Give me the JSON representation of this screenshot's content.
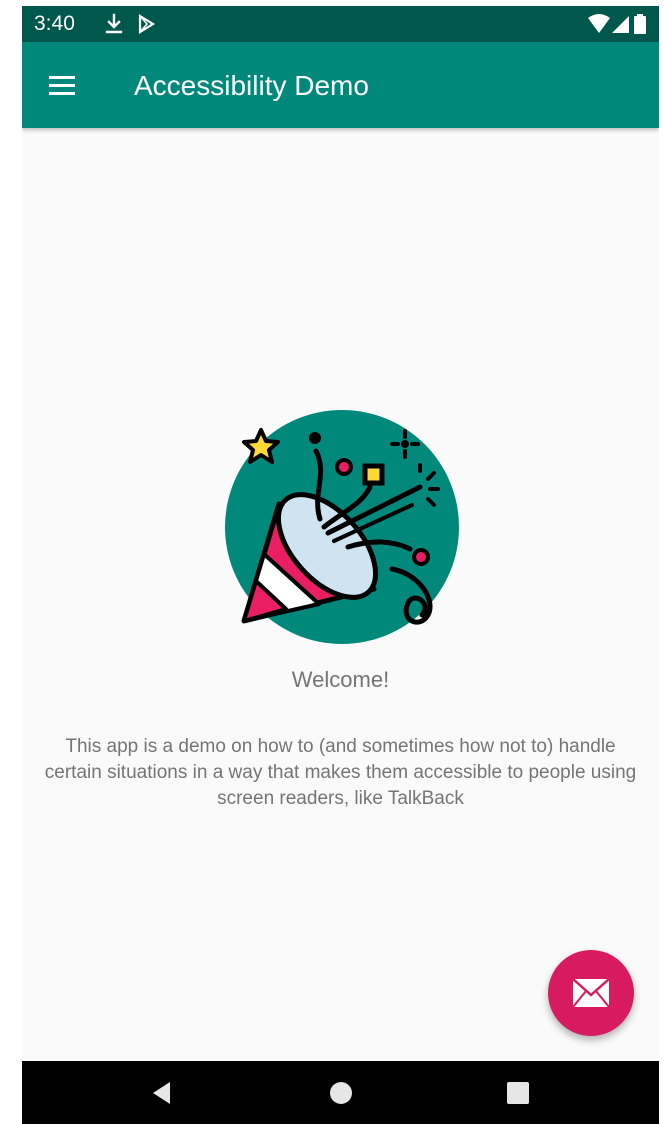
{
  "status_bar": {
    "time": "3:40",
    "icons": [
      "download-icon",
      "play-store-icon",
      "wifi-icon",
      "signal-icon",
      "battery-icon"
    ]
  },
  "app_bar": {
    "title": "Accessibility Demo",
    "menu_icon": "hamburger-menu-icon"
  },
  "main": {
    "hero_image": "party-popper-icon",
    "welcome": "Welcome!",
    "description": "This app is a demo on how to (and sometimes how not to) handle certain situations in a way that makes them accessible to people using screen readers, like TalkBack"
  },
  "fab": {
    "icon": "mail-icon"
  },
  "nav_bar": {
    "buttons": [
      "back-icon",
      "home-icon",
      "recents-icon"
    ]
  },
  "colors": {
    "status_bar": "#00574b",
    "primary": "#00897b",
    "accent": "#d81b60",
    "background": "#fafafa",
    "text_secondary": "#757575"
  }
}
